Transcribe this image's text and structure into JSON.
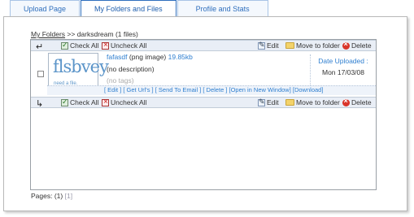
{
  "tabs": [
    {
      "label": "Upload Page"
    },
    {
      "label": "My Folders and Files"
    },
    {
      "label": "Profile and Stats"
    }
  ],
  "breadcrumb": {
    "root": "My Folders",
    "rest": " >> darksdream (1 files)"
  },
  "toolbar": {
    "check_all": "Check All",
    "uncheck_all": "Uncheck All",
    "edit": "Edit",
    "move_to_folder": "Move to folder",
    "delete": "Delete"
  },
  "file": {
    "thumb_logo": "flsbvey",
    "thumb_tagline": "need a file.",
    "name": "fafasdf",
    "type": "(png image)",
    "size": "19.85kb",
    "description": "(no description)",
    "tags": "(no tags)",
    "date_label": "Date Uploaded :",
    "date_value": "Mon 17/03/08",
    "links": [
      "[ Edit ]",
      "[ Get Url's ]",
      "[ Send To Email ]",
      "[ Delete ]",
      "[Open in New Window]",
      "[Download]"
    ]
  },
  "pagination": {
    "label": "Pages:",
    "current": "(1)",
    "other": "[1]"
  }
}
